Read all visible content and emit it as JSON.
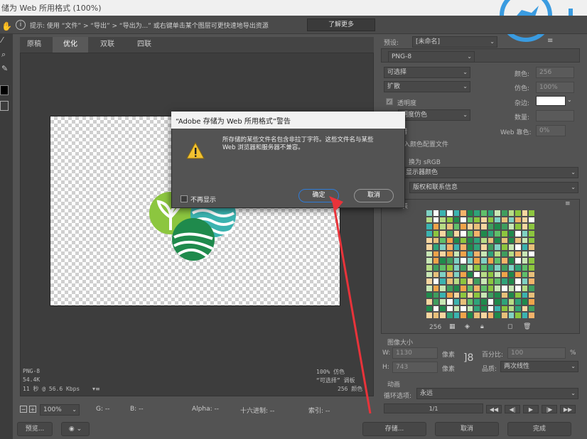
{
  "window": {
    "title": "储为 Web 所用格式 (100%)"
  },
  "hint": {
    "icon": "info-icon",
    "text": "提示: 使用 “文件” > “导出” > “导出为...” 或右键单击某个图层可更快速地导出资源",
    "learn_more": "了解更多"
  },
  "tabs": [
    "原稿",
    "优化",
    "双联",
    "四联"
  ],
  "active_tab": 1,
  "preview_info": {
    "left": [
      "PNG-8",
      "54.4K",
      "11 秒 @ 56.6 Kbps"
    ],
    "right": [
      "100% 仿色",
      "“可选择” 调板",
      "256 颜色"
    ]
  },
  "status": {
    "zoom": "100%",
    "g": "G: --",
    "b": "B: --",
    "alpha": "Alpha: --",
    "hex": "十六进制: --",
    "index": "索引: --"
  },
  "bottom": {
    "preview": "预览...",
    "save": "存储...",
    "cancel": "取消",
    "done": "完成"
  },
  "settings": {
    "preset_label": "预设:",
    "preset_value": "[未命名]",
    "format": "PNG-8",
    "reduction": "可选择",
    "dither_algo": "扩散",
    "transparency_label": "透明度",
    "transparency_dither": "明度仿色",
    "colors_label": "颜色:",
    "colors_value": "256",
    "dither_label": "仿色:",
    "dither_value": "100%",
    "matte_label": "杂边:",
    "amount_label": "数量:",
    "web_snap_label": "Web 靠色:",
    "web_snap_value": "0%",
    "interlaced_label": "错",
    "embed_profile": "入颜色配置文件",
    "convert_srgb": "换为 sRGB",
    "preview_mode": "显示器颜色",
    "metadata": "版权和联系信息",
    "color_table_label": "表",
    "color_count": "256"
  },
  "image_size": {
    "heading": "图像大小",
    "w_label": "W:",
    "w_value": "1130",
    "h_label": "H:",
    "h_value": "743",
    "unit": "像素",
    "percent_label": "百分比:",
    "percent_value": "100",
    "percent_unit": "%",
    "quality_label": "品质:",
    "quality_value": "两次线性"
  },
  "animation": {
    "heading": "动画",
    "loop_label": "循环选项:",
    "loop_value": "永远",
    "frame": "1/1"
  },
  "dialog": {
    "title": "“Adobe 存储为 Web 所用格式”警告",
    "message_line1": "所存储的某些文件名包含非拉丁字符。这些文件名与某些",
    "message_line2": "Web 浏览器和服务器不兼容。",
    "checkbox_label": "不再显示",
    "ok": "确定",
    "cancel": "取消"
  },
  "colors": {
    "annotation_arrow": "#e8333a",
    "dialog_ok_border": "#2f7bd6",
    "watermark": "#3a9be0",
    "logo_light_green": "#8cc63f",
    "logo_dark_green": "#1f8a4c",
    "logo_teal": "#3bb3b0"
  }
}
